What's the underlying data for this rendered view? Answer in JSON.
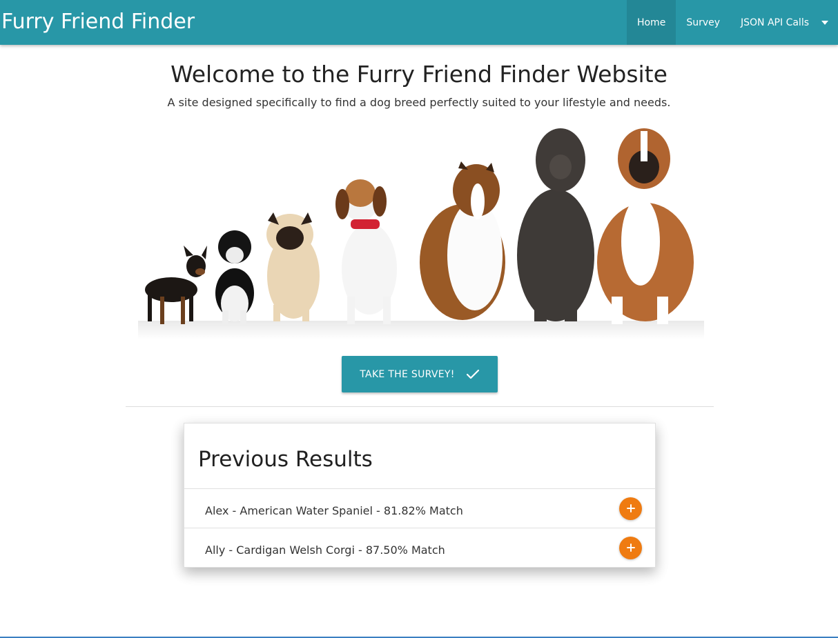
{
  "nav": {
    "brand": "Furry Friend Finder",
    "links": [
      {
        "label": "Home",
        "active": true
      },
      {
        "label": "Survey",
        "active": false
      },
      {
        "label": "JSON API Calls",
        "active": false
      }
    ]
  },
  "hero": {
    "title": "Welcome to the Furry Friend Finder Website",
    "subtitle": "A site designed specifically to find a dog breed perfectly suited to your lifestyle and needs."
  },
  "survey_button": {
    "label": "TAKE THE SURVEY!",
    "icon": "check-icon"
  },
  "results": {
    "title": "Previous Results",
    "items": [
      {
        "label": "Alex - American Water Spaniel - 81.82% Match",
        "icon": "plus-icon"
      },
      {
        "label": "Ally - Cardigan Welsh Corgi - 87.50% Match",
        "icon": "plus-icon"
      }
    ]
  },
  "colors": {
    "primary": "#2897a7",
    "accent": "#ef7b11",
    "text": "#212121"
  }
}
